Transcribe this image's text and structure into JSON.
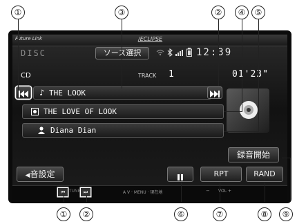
{
  "callouts": {
    "c1_top": "①",
    "c2_top": "②",
    "c3_top": "③",
    "c4_top": "④",
    "c5_top": "⑤",
    "c1_bot": "①",
    "c2_bot": "②",
    "c6_bot": "⑥",
    "c7_bot": "⑦",
    "c8_bot": "⑧",
    "c9_bot": "⑨"
  },
  "header": {
    "brand_left": "Future Link",
    "brand_center": "∕ECLIPSE",
    "mode": "DISC",
    "source_select": "ソース選択",
    "clock": "12:39",
    "status_icons": [
      "wifi-icon",
      "bluetooth-icon",
      "signal-icon",
      "battery-icon"
    ]
  },
  "info": {
    "media": "CD",
    "track_label": "TRACK",
    "track_number": "1",
    "elapsed": "01'23\""
  },
  "rows": {
    "song_title": "THE LOOK",
    "album_title": "THE LOVE OF LOOK",
    "artist": "Diana Dian"
  },
  "buttons": {
    "record_start": "録音開始",
    "sound_settings": "音設定",
    "pause": "⏸",
    "repeat": "RPT",
    "random": "RAND"
  },
  "panel": {
    "tune_label": "TUNE",
    "av_menu_label": "A V · MENU · 現在地",
    "vol_label": "VOL +",
    "vol_minus": "−"
  },
  "colors": {
    "screen_bg": "#141414",
    "frame": "#0b0b0b",
    "accent_white": "#ffffff"
  }
}
